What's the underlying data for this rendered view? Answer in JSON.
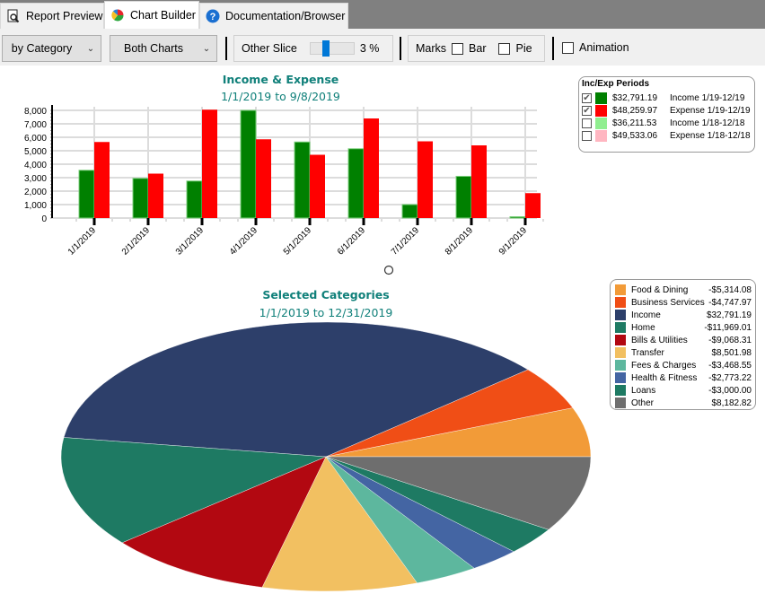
{
  "tabs": [
    {
      "label": "Report Preview",
      "icon": "report-preview-icon",
      "active": false
    },
    {
      "label": "Chart Builder",
      "icon": "pie-chart-icon",
      "active": true
    },
    {
      "label": "Documentation/Browser",
      "icon": "help-icon",
      "active": false
    }
  ],
  "toolbar": {
    "grouping_select": "by Category",
    "chart_select": "Both Charts",
    "other_slice_label": "Other Slice",
    "other_slice_value": "3 %",
    "other_slice_fraction": 0.3,
    "marks_label": "Marks",
    "bar_label": "Bar",
    "bar_checked": false,
    "pie_label": "Pie",
    "pie_checked": false,
    "animation_label": "Animation",
    "animation_checked": false
  },
  "periods_legend": {
    "title": "Inc/Exp Periods",
    "items": [
      {
        "checked": true,
        "color": "#008000",
        "amount": "$32,791.19",
        "label": "Income 1/19-12/19"
      },
      {
        "checked": true,
        "color": "#ff0000",
        "amount": "$48,259.97",
        "label": "Expense 1/19-12/19"
      },
      {
        "checked": false,
        "color": "#90ee90",
        "amount": "$36,211.53",
        "label": "Income 1/18-12/18"
      },
      {
        "checked": false,
        "color": "#ffb6c1",
        "amount": "$49,533.06",
        "label": "Expense 1/18-12/18"
      }
    ]
  },
  "categories_legend": {
    "items": [
      {
        "name": "Food & Dining",
        "value": "-$5,314.08",
        "color": "#f29b38"
      },
      {
        "name": "Business Services",
        "value": "-$4,747.97",
        "color": "#f04e16"
      },
      {
        "name": "Income",
        "value": "$32,791.19",
        "color": "#2d3f6a"
      },
      {
        "name": "Home",
        "value": "-$11,969.01",
        "color": "#1e7a63"
      },
      {
        "name": "Bills & Utilities",
        "value": "-$9,068.31",
        "color": "#b20811"
      },
      {
        "name": "Transfer",
        "value": "$8,501.98",
        "color": "#f2c061"
      },
      {
        "name": "Fees & Charges",
        "value": "-$3,468.55",
        "color": "#5db79e"
      },
      {
        "name": "Health & Fitness",
        "value": "-$2,773.22",
        "color": "#4465a3"
      },
      {
        "name": "Loans",
        "value": "-$3,000.00",
        "color": "#1e7a63"
      },
      {
        "name": "Other",
        "value": "$8,182.82",
        "color": "#6e6e6e"
      }
    ]
  },
  "chart_data": [
    {
      "type": "bar",
      "title": "Income & Expense",
      "subtitle": "1/1/2019 to 9/8/2019",
      "xlabel": "",
      "ylabel": "",
      "categories": [
        "1/1/2019",
        "2/1/2019",
        "3/1/2019",
        "4/1/2019",
        "5/1/2019",
        "6/1/2019",
        "7/1/2019",
        "8/1/2019",
        "9/1/2019"
      ],
      "series": [
        {
          "name": "Income 1/19-12/19",
          "color": "#008000",
          "values": [
            3550,
            2950,
            2750,
            8000,
            5650,
            5150,
            1000,
            3100,
            100
          ]
        },
        {
          "name": "Expense 1/19-12/19",
          "color": "#ff0000",
          "values": [
            5650,
            3300,
            8050,
            5850,
            4700,
            7400,
            5700,
            5400,
            1850
          ]
        }
      ],
      "ylim": [
        0,
        8000
      ],
      "yticks": [
        "0",
        "1,000",
        "2,000",
        "3,000",
        "4,000",
        "5,000",
        "6,000",
        "7,000",
        "8,000"
      ],
      "ytick_values": [
        0,
        1000,
        2000,
        3000,
        4000,
        5000,
        6000,
        7000,
        8000
      ],
      "grid": true,
      "legend": "top-right"
    },
    {
      "type": "pie",
      "title": "Selected Categories",
      "subtitle": "1/1/2019 to 12/31/2019",
      "slices": [
        {
          "name": "Food & Dining",
          "value": 5314.08,
          "color": "#f29b38"
        },
        {
          "name": "Business Services",
          "value": 4747.97,
          "color": "#f04e16"
        },
        {
          "name": "Income",
          "value": 32791.19,
          "color": "#2d3f6a"
        },
        {
          "name": "Home",
          "value": 11969.01,
          "color": "#1e7a63"
        },
        {
          "name": "Bills & Utilities",
          "value": 9068.31,
          "color": "#b20811"
        },
        {
          "name": "Transfer",
          "value": 8501.98,
          "color": "#f2c061"
        },
        {
          "name": "Fees & Charges",
          "value": 3468.55,
          "color": "#5db79e"
        },
        {
          "name": "Health & Fitness",
          "value": 2773.22,
          "color": "#4465a3"
        },
        {
          "name": "Loans",
          "value": 3000.0,
          "color": "#1e7a63"
        },
        {
          "name": "Other",
          "value": 8182.82,
          "color": "#6e6e6e"
        }
      ],
      "legend": "right"
    }
  ]
}
